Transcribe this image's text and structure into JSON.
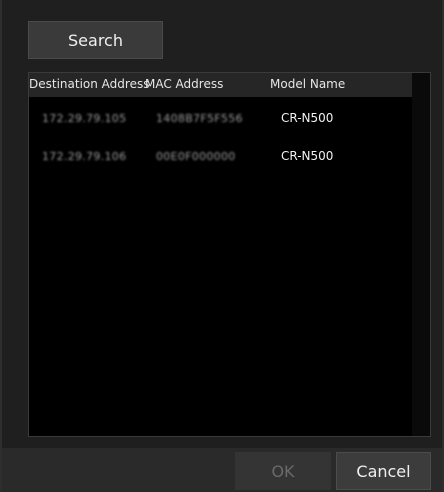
{
  "toolbar": {
    "search_label": "Search"
  },
  "list": {
    "columns": [
      "Destination Address",
      "MAC Address",
      "Model Name"
    ],
    "rows": [
      {
        "destination": "172.29.79.105",
        "mac": "1408B7F5F556",
        "model": "CR-N500"
      },
      {
        "destination": "172.29.79.106",
        "mac": "00E0F000000",
        "model": "CR-N500"
      }
    ]
  },
  "footer": {
    "ok_label": "OK",
    "cancel_label": "Cancel",
    "ok_enabled": false
  },
  "colors": {
    "background": "#1f1f1f",
    "list_background": "#000000",
    "header_background": "#262626",
    "button_background": "#3a3a3a",
    "disabled_text": "#6a6a6a"
  }
}
